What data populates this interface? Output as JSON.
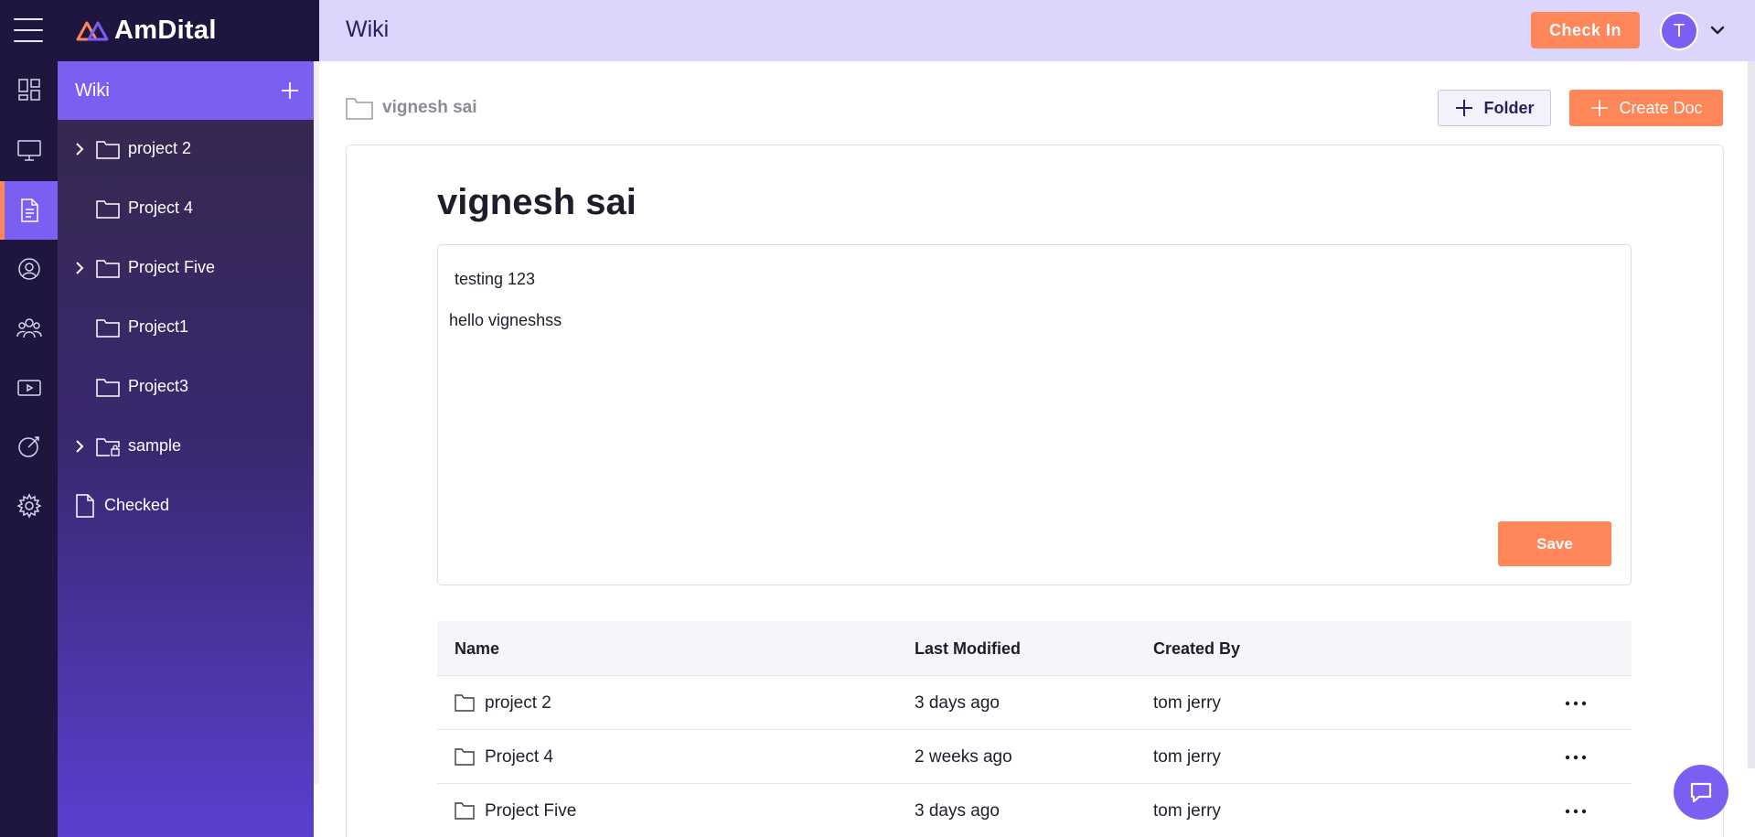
{
  "brand": {
    "name": "AmDital"
  },
  "header": {
    "title": "Wiki",
    "check_in_label": "Check In",
    "avatar_initial": "T"
  },
  "rail": {
    "items": [
      {
        "icon": "dashboard-icon"
      },
      {
        "icon": "monitor-icon"
      },
      {
        "icon": "document-icon",
        "active": true
      },
      {
        "icon": "profile-network-icon"
      },
      {
        "icon": "team-icon"
      },
      {
        "icon": "video-icon"
      },
      {
        "icon": "target-icon"
      },
      {
        "icon": "gear-icon"
      }
    ]
  },
  "sidebar": {
    "title": "Wiki",
    "items": [
      {
        "label": "project 2",
        "type": "folder",
        "expandable": true
      },
      {
        "label": "Project 4",
        "type": "folder",
        "expandable": false
      },
      {
        "label": "Project Five",
        "type": "folder",
        "expandable": true
      },
      {
        "label": "Project1",
        "type": "folder",
        "expandable": false
      },
      {
        "label": "Project3",
        "type": "folder",
        "expandable": false
      },
      {
        "label": "sample",
        "type": "locked-folder",
        "expandable": true
      },
      {
        "label": "Checked",
        "type": "document",
        "expandable": false
      }
    ]
  },
  "breadcrumb": {
    "current": "vignesh sai"
  },
  "toolbar": {
    "folder_label": "Folder",
    "create_doc_label": "Create Doc"
  },
  "doc": {
    "title": "vignesh sai",
    "content_line1": "testing 123",
    "content_line2": "hello vigneshss",
    "save_label": "Save"
  },
  "table": {
    "columns": [
      "Name",
      "Last Modified",
      "Created By"
    ],
    "rows": [
      {
        "name": "project 2",
        "modified": "3 days ago",
        "created_by": "tom jerry"
      },
      {
        "name": "Project 4",
        "modified": "2 weeks ago",
        "created_by": "tom jerry"
      },
      {
        "name": "Project Five",
        "modified": "3 days ago",
        "created_by": "tom jerry"
      }
    ]
  },
  "colors": {
    "accent_purple": "#7b5ff2",
    "accent_orange": "#ff8659",
    "rail_dark": "#1f1640",
    "appbar_lavender": "#dcd6fc"
  }
}
